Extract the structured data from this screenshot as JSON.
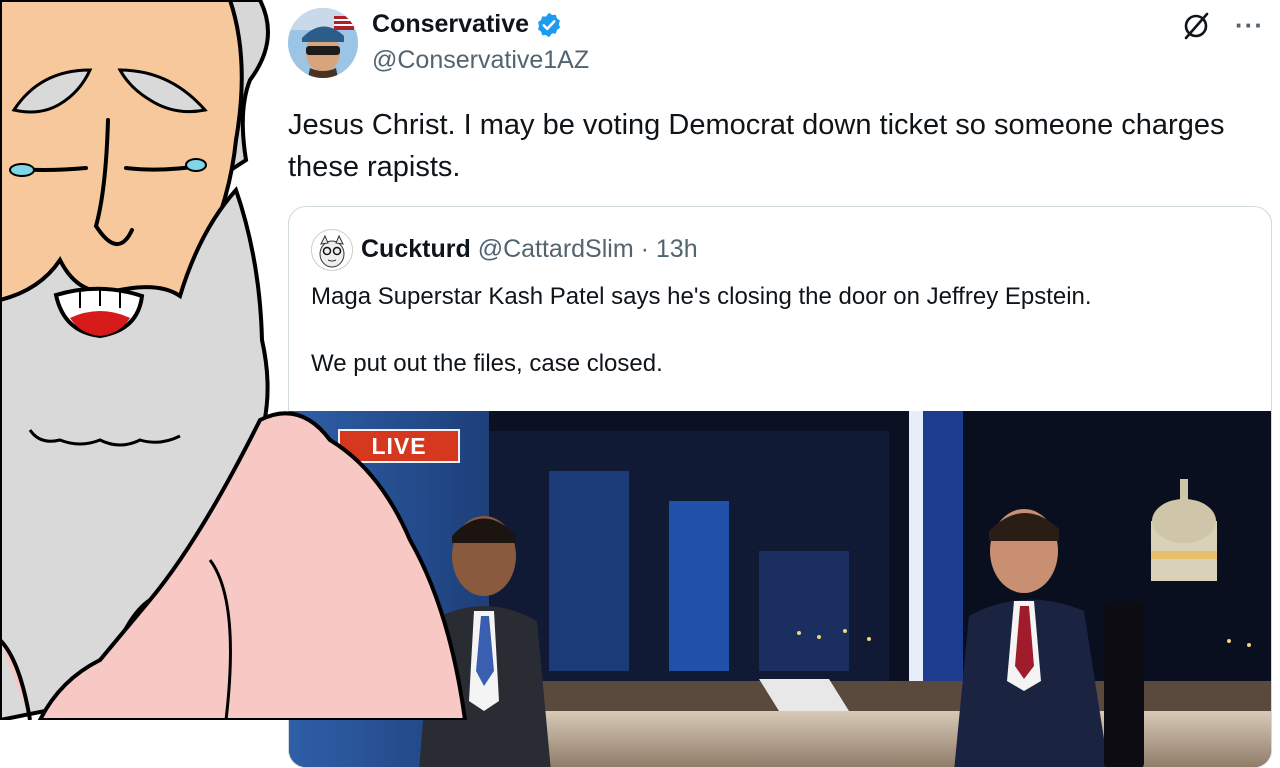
{
  "tweet": {
    "display_name": "Conservative",
    "handle": "@Conservative1AZ",
    "text": "Jesus Christ. I may be voting Democrat down ticket so someone charges these rapists.",
    "more_label": "···"
  },
  "quoted": {
    "display_name": "Cuckturd",
    "handle": "@CattardSlim",
    "separator": "·",
    "time": "13h",
    "line1": "Maga Superstar Kash Patel says he's closing the door on Jeffrey Epstein.",
    "line2": "We put out the files, case closed.",
    "video_badge": "LIVE"
  },
  "colors": {
    "verified": "#1d9bf0",
    "handle_gray": "#536471",
    "border": "#cfd9de",
    "live_red": "#d6381f"
  },
  "icons": [
    "verified-badge-icon",
    "grok-icon",
    "more-icon"
  ]
}
